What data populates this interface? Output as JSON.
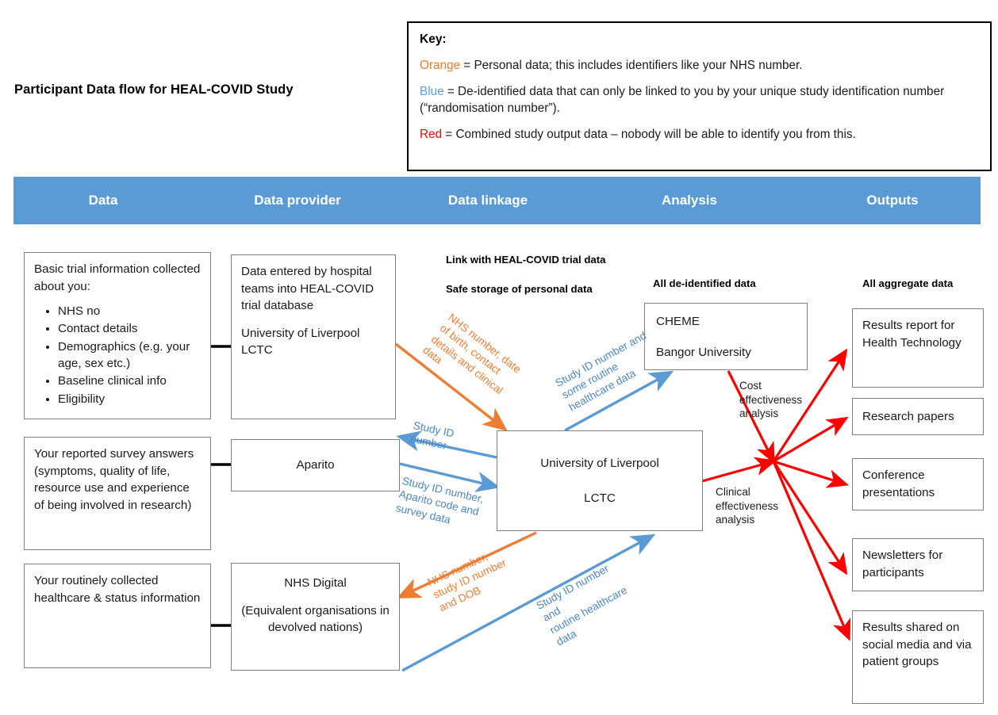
{
  "page": {
    "title": "Participant Data flow for HEAL-COVID Study"
  },
  "key": {
    "heading": "Key:",
    "lines": [
      {
        "term": "Orange",
        "color": "#ED7D31",
        "rest": " = Personal data; this includes identifiers like your NHS number."
      },
      {
        "term": "Blue",
        "color": "#5B9BD5",
        "rest": " = De-identified data that can only be linked to you by your unique study identification number (“randomisation number”)."
      },
      {
        "term": "Red",
        "color": "#FF0000",
        "rest": " = Combined study output data – nobody will be able to identify you from this."
      }
    ]
  },
  "band": {
    "color": "#5B9BD5",
    "columns": [
      {
        "label": "Data"
      },
      {
        "label": "Data provider"
      },
      {
        "label": "Data linkage"
      },
      {
        "label": "Analysis"
      },
      {
        "label": "Outputs"
      }
    ]
  },
  "mini_headings": {
    "link_trial": "Link with HEAL-COVID trial data",
    "safe_storage": "Safe storage of personal data",
    "all_deidentified": "All de-identified data",
    "all_aggregate": "All aggregate data"
  },
  "data_column": {
    "basic_trial": {
      "intro": "Basic trial information collected about you:",
      "bullets": [
        "NHS no",
        "Contact details",
        "Demographics (e.g. your age, sex etc.)",
        "Baseline clinical info",
        "Eligibility"
      ]
    },
    "survey": "Your reported survey answers (symptoms, quality of life, resource use and experience of being involved in research)",
    "routine": "Your routinely collected healthcare & status information"
  },
  "provider_column": {
    "hospital_entry_p1": "Data entered by hospital teams into HEAL-COVID trial database",
    "hospital_entry_p2": "University of Liverpool LCTC",
    "aparito": "Aparito",
    "nhs_digital_p1": "NHS Digital",
    "nhs_digital_p2": "(Equivalent organisations in devolved nations)"
  },
  "linkage_column": {
    "hub_p1": "University of Liverpool",
    "hub_p2": "LCTC"
  },
  "analysis_column": {
    "cheme_p1": "CHEME",
    "cheme_p2": "Bangor University",
    "cost_effectiveness": "Cost effectiveness analysis",
    "clinical_effectiveness": "Clinical effectiveness analysis"
  },
  "outputs_column": {
    "boxes": [
      {
        "label": "Results report for Health Technology"
      },
      {
        "label": "Research papers"
      },
      {
        "label": "Conference presentations"
      },
      {
        "label": "Newsletters for participants"
      },
      {
        "label": "Results shared on social media and via patient groups"
      }
    ]
  },
  "arrow_captions": {
    "nhs_number_dob_clinical": "NHS number, date\nof birth, contact\ndetails and clinical\ndata",
    "study_id_number": "Study ID\nnumber",
    "study_id_aparito_survey": "Study ID number,\nAparito code and\nsurvey data",
    "nhs_number_studyid_dob": "NHS number,\nstudy ID number\nand DOB",
    "study_id_routine_healthcare": "Study ID number and\nroutine healthcare\ndata",
    "study_id_some_routine": "Study ID number and\nsome routine\nhealthcare data"
  },
  "colors": {
    "orange": "#ED7D31",
    "blue": "#5B9BD5",
    "blue_text": "#4A86C8",
    "red": "#FF0000",
    "box_border": "#7f7f7f",
    "black": "#000000"
  }
}
